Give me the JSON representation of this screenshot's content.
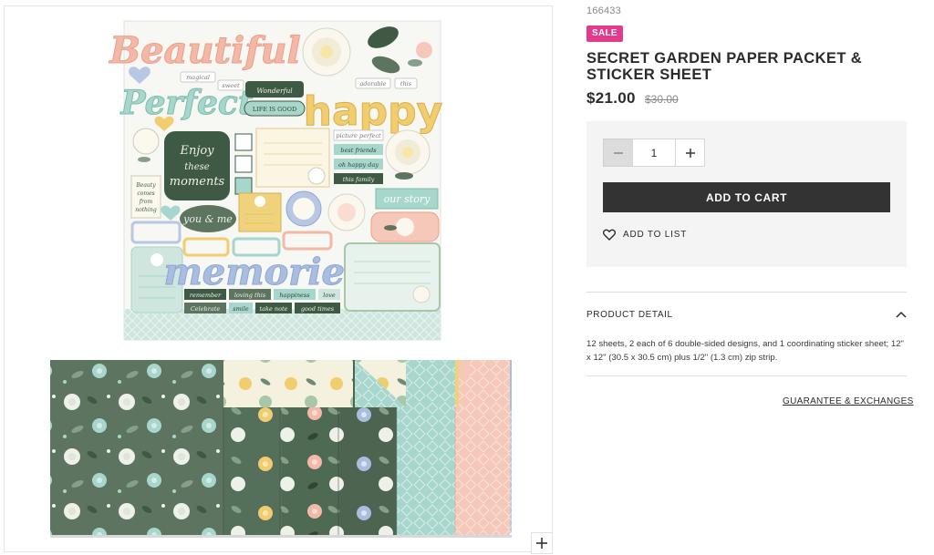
{
  "product": {
    "sku": "166433",
    "badge": "SALE",
    "title": "SECRET GARDEN PAPER PACKET & STICKER SHEET",
    "price": "$21.00",
    "original_price": "$30.00"
  },
  "sticker_sheet": {
    "words": {
      "beautiful": "Beautiful",
      "perfect": "Perfect",
      "happy": "happy",
      "memories": "memories",
      "enjoy_1": "Enjoy",
      "enjoy_2": "these",
      "enjoy_3": "moments",
      "beauty_1": "Beauty",
      "beauty_2": "comes",
      "beauty_3": "from",
      "beauty_4": "nothing",
      "you_me": "you & me",
      "our_story": "our story",
      "magical": "magical",
      "sweet": "sweet",
      "wonderful": "Wonderful",
      "adorable": "adorable",
      "this": "this",
      "life_is_good": "LIFE IS GOOD",
      "picture_perfect": "picture perfect",
      "best_friends": "best friends",
      "oh_happy_day": "oh happy day",
      "this_family": "this family"
    },
    "tags": [
      "remember",
      "loving this",
      "happiness",
      "love",
      "Celebrate",
      "smile",
      "take note",
      "good times"
    ]
  },
  "cart": {
    "quantity": "1",
    "add_to_cart_label": "ADD TO CART",
    "add_to_list_label": "ADD TO LIST"
  },
  "detail": {
    "heading": "PRODUCT DETAIL",
    "description": "12 sheets, 2 each of 6 double-sided designs, and 1 coordinating sticker sheet; 12\" x 12\" (30.5 x 30.5 cm) plus 1/2\" (1.3 cm) zip strip.",
    "guarantee_link": "GUARANTEE & EXCHANGES"
  },
  "icons": {
    "zoom": "plus-icon",
    "minus": "minus-icon",
    "plus": "plus-icon",
    "heart": "heart-icon",
    "chevron": "chevron-up-icon"
  },
  "colors": {
    "sale_badge": "#e43a8c",
    "cart_button": "#333333",
    "cart_box_bg": "#f4f4f4",
    "sage_green": "#5d7460",
    "mint": "#a7d6cc",
    "peach": "#f3b9a6",
    "butter_yellow": "#f1cd70",
    "periwinkle": "#a9bde0",
    "dark_green": "#3f5a44"
  }
}
